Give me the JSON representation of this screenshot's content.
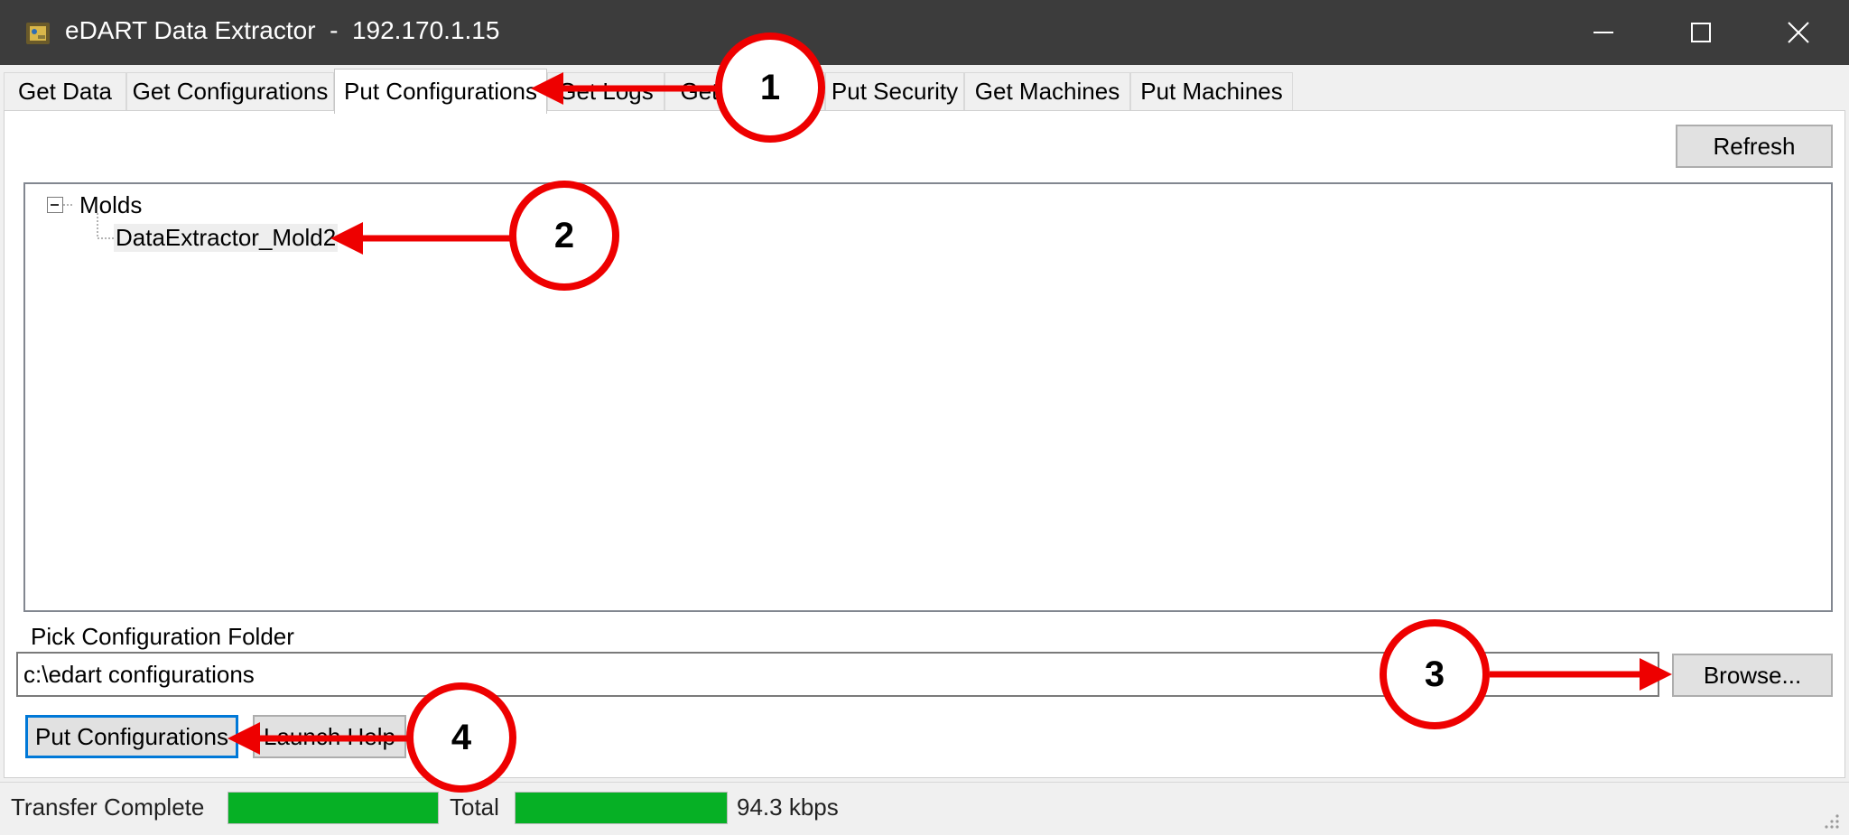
{
  "window": {
    "title": "eDART Data Extractor  -  192.170.1.15",
    "icon": "edart-app-icon",
    "controls": [
      "minimize-icon",
      "maximize-icon",
      "close-icon"
    ]
  },
  "tabs": [
    {
      "label": "Get Data",
      "active": false
    },
    {
      "label": "Get Configurations",
      "active": false
    },
    {
      "label": "Put Configurations",
      "active": true
    },
    {
      "label": "Get Logs",
      "active": false
    },
    {
      "label": "Get Security",
      "active": false
    },
    {
      "label": "Put Security",
      "active": false
    },
    {
      "label": "Get Machines",
      "active": false
    },
    {
      "label": "Put Machines",
      "active": false
    }
  ],
  "panel": {
    "refresh_label": "Refresh",
    "tree": {
      "root": "Molds",
      "children": [
        "DataExtractor_Mold2"
      ]
    },
    "folder_label": "Pick Configuration Folder",
    "folder_value": "c:\\edart configurations",
    "browse_label": "Browse...",
    "put_label": "Put Configurations",
    "help_label": "Launch Help"
  },
  "status": {
    "text": "Transfer Complete",
    "progress1": 1.0,
    "total_label": "Total",
    "progress2": 1.0,
    "rate": "94.3 kbps"
  },
  "annotations": {
    "color": "#ee0000",
    "callouts": [
      "1",
      "2",
      "3",
      "4"
    ]
  }
}
